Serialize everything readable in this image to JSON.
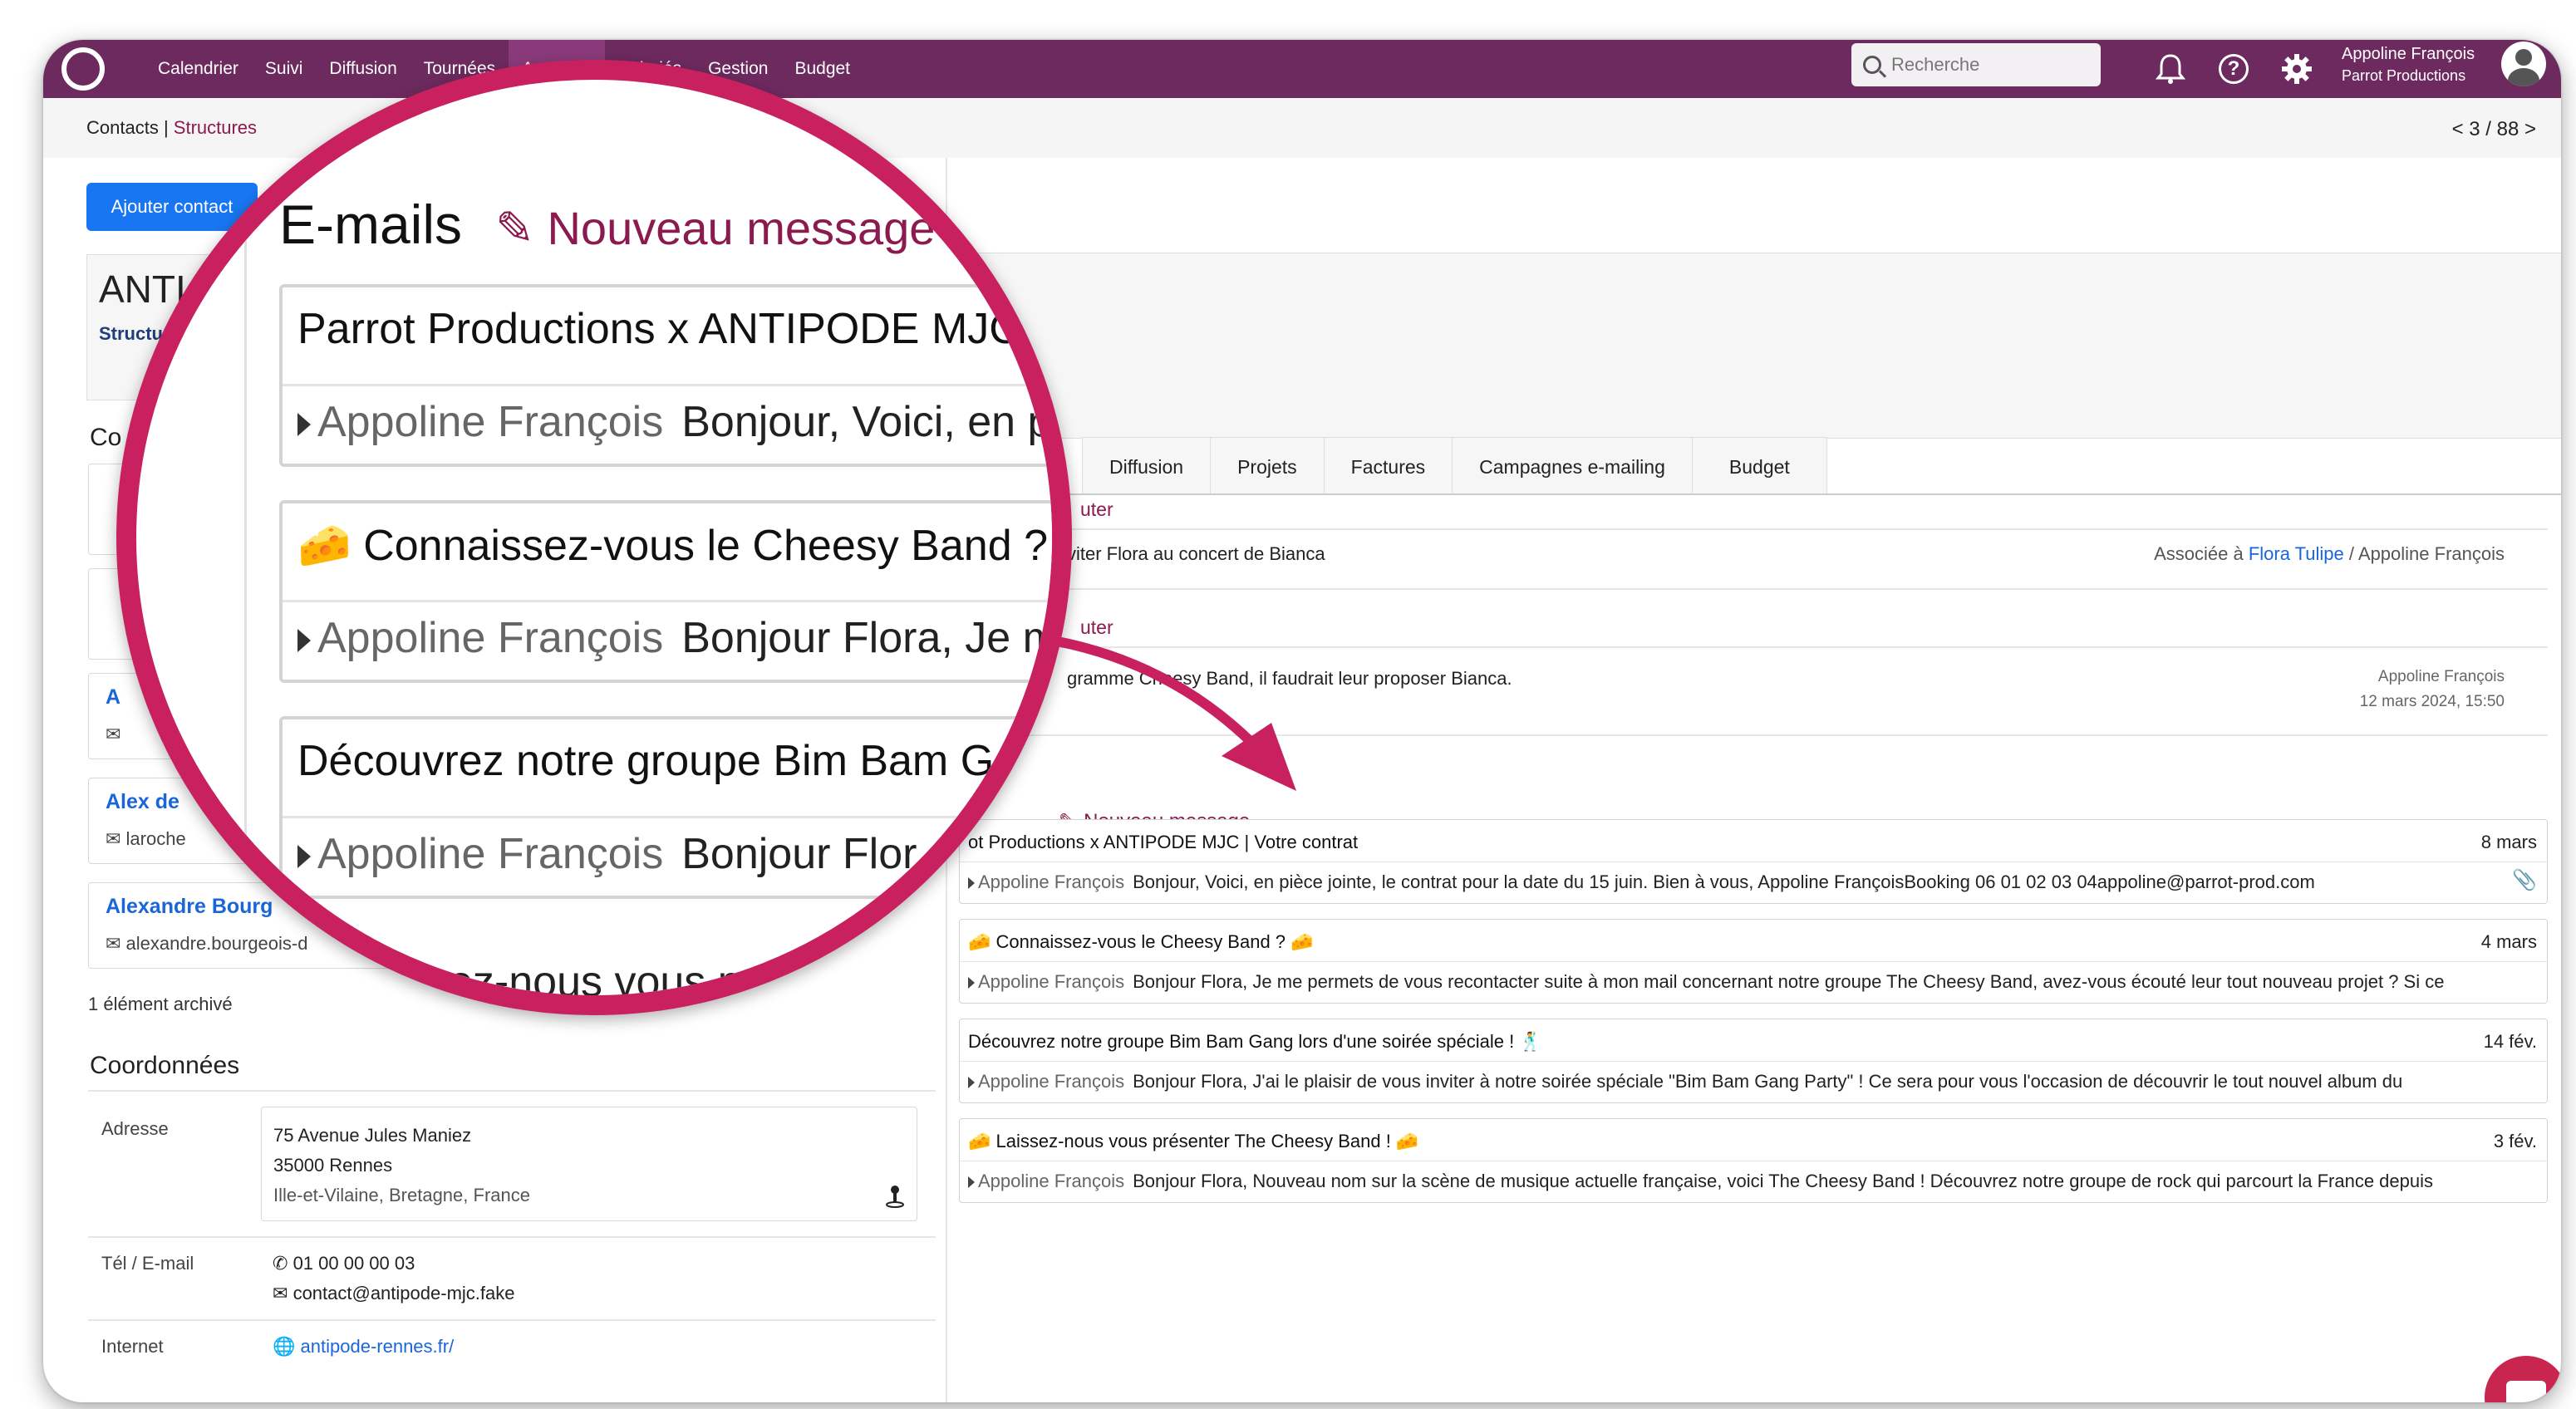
{
  "topbar": {
    "nav": [
      "Calendrier",
      "Suivi",
      "Diffusion",
      "Tournées",
      "Annuaire",
      "Salariés",
      "Gestion",
      "Budget"
    ],
    "search_placeholder": "Recherche",
    "user_name": "Appoline François",
    "user_org": "Parrot Productions"
  },
  "subbar": {
    "crumb_contacts": "Contacts",
    "crumb_sep": " | ",
    "crumb_structures": "Structures",
    "pager": "< 3 / 88 >"
  },
  "left": {
    "add_contact": "Ajouter contact",
    "struct_name": "ANTI",
    "struct_type": "Structu",
    "contacts_title": "Co",
    "contacts": [
      {
        "name": "A",
        "email": ""
      },
      {
        "name": "Alex de",
        "email": "laroche"
      },
      {
        "name": "Alexandre Bourg",
        "email": "alexandre.bourgeois-d"
      }
    ],
    "archived": "1 élément archivé",
    "coord_title": "Coordonnées",
    "address_label": "Adresse",
    "address_line1": "75 Avenue Jules Maniez",
    "address_line2": "35000 Rennes",
    "address_line3": "Ille-et-Vilaine, Bretagne, France",
    "phone_label": "Tél / E-mail",
    "phone": "01 00 00 00 03",
    "email": "contact@antipode-mjc.fake",
    "internet_label": "Internet",
    "website": "antipode-rennes.fr/"
  },
  "tabs": [
    "Diffusion",
    "Projets",
    "Factures",
    "Campagnes e-mailing",
    "Budget"
  ],
  "tasks": {
    "add1": "uter",
    "task_text": "viter Flora au concert de Bianca",
    "assoc_prefix": "Associée à ",
    "assoc_contact": "Flora Tulipe",
    "assoc_user": " /  Appoline François",
    "add2": "uter",
    "note_text": "gramme   Cheesy Band, il faudrait leur proposer Bianca.",
    "note_author": "Appoline François",
    "note_date": "12 mars 2024, 15:50"
  },
  "emails": {
    "new_message": "Nouveau message",
    "items": [
      {
        "subject": "ot Productions x ANTIPODE MJC | Votre contrat",
        "date": "8 mars",
        "from": "Appoline François",
        "preview": "Bonjour,   Voici, en pièce jointe, le contrat pour la date du 15 juin.   Bien à vous,    Appoline FrançoisBooking 06 01 02 03 04appoline@parrot-prod.com",
        "attachment": true
      },
      {
        "subject": "🧀 Connaissez-vous le Cheesy Band ? 🧀",
        "date": "4 mars",
        "from": "Appoline François",
        "preview": "Bonjour Flora, Je me permets de vous recontacter suite à mon mail concernant notre groupe The Cheesy Band, avez-vous écouté leur tout nouveau projet ? Si ce",
        "attachment": false
      },
      {
        "subject": "Découvrez notre groupe Bim Bam Gang lors d'une soirée spéciale ! 🕺",
        "date": "14 fév.",
        "from": "Appoline François",
        "preview": "Bonjour Flora, J'ai le plaisir de vous inviter à notre soirée spéciale \"Bim Bam Gang Party\" ! Ce sera pour vous l'occasion de découvrir le tout nouvel album du",
        "attachment": false
      },
      {
        "subject": "🧀 Laissez-nous vous présenter The Cheesy Band ! 🧀",
        "date": "3 fév.",
        "from": "Appoline François",
        "preview": "Bonjour Flora, Nouveau nom sur la scène de musique actuelle française, voici The Cheesy Band ! Découvrez notre groupe de rock qui parcourt la France depuis",
        "attachment": false
      }
    ]
  },
  "magnifier": {
    "title": "E-mails",
    "new_message": "Nouveau message",
    "cards": [
      {
        "subject": "Parrot Productions x ANTIPODE MJC",
        "from": "Appoline François",
        "preview": "Bonjour,   Voici, en p"
      },
      {
        "subject": "🧀 Connaissez-vous le Cheesy Band ? 🧀",
        "from": "Appoline François",
        "preview": "Bonjour Flora, Je m"
      },
      {
        "subject": "Découvrez notre groupe Bim Bam Ga",
        "from": "Appoline François",
        "preview": "Bonjour Flor"
      }
    ],
    "bottom_text": "ez-nous vous p"
  },
  "colors": {
    "topbar": "#6d2a5f",
    "accent": "#8b1a4f",
    "magnifier_ring": "#c9205f",
    "primary_button": "#1976f2",
    "link": "#1a66d8"
  },
  "icons": {
    "logo": "circle-logo-icon",
    "bell": "bell-icon",
    "help": "help-icon",
    "settings": "gear-icon",
    "avatar": "user-avatar-icon",
    "pencil": "pencil-icon",
    "attachment": "paperclip-icon",
    "chat": "chat-bubble-icon"
  }
}
